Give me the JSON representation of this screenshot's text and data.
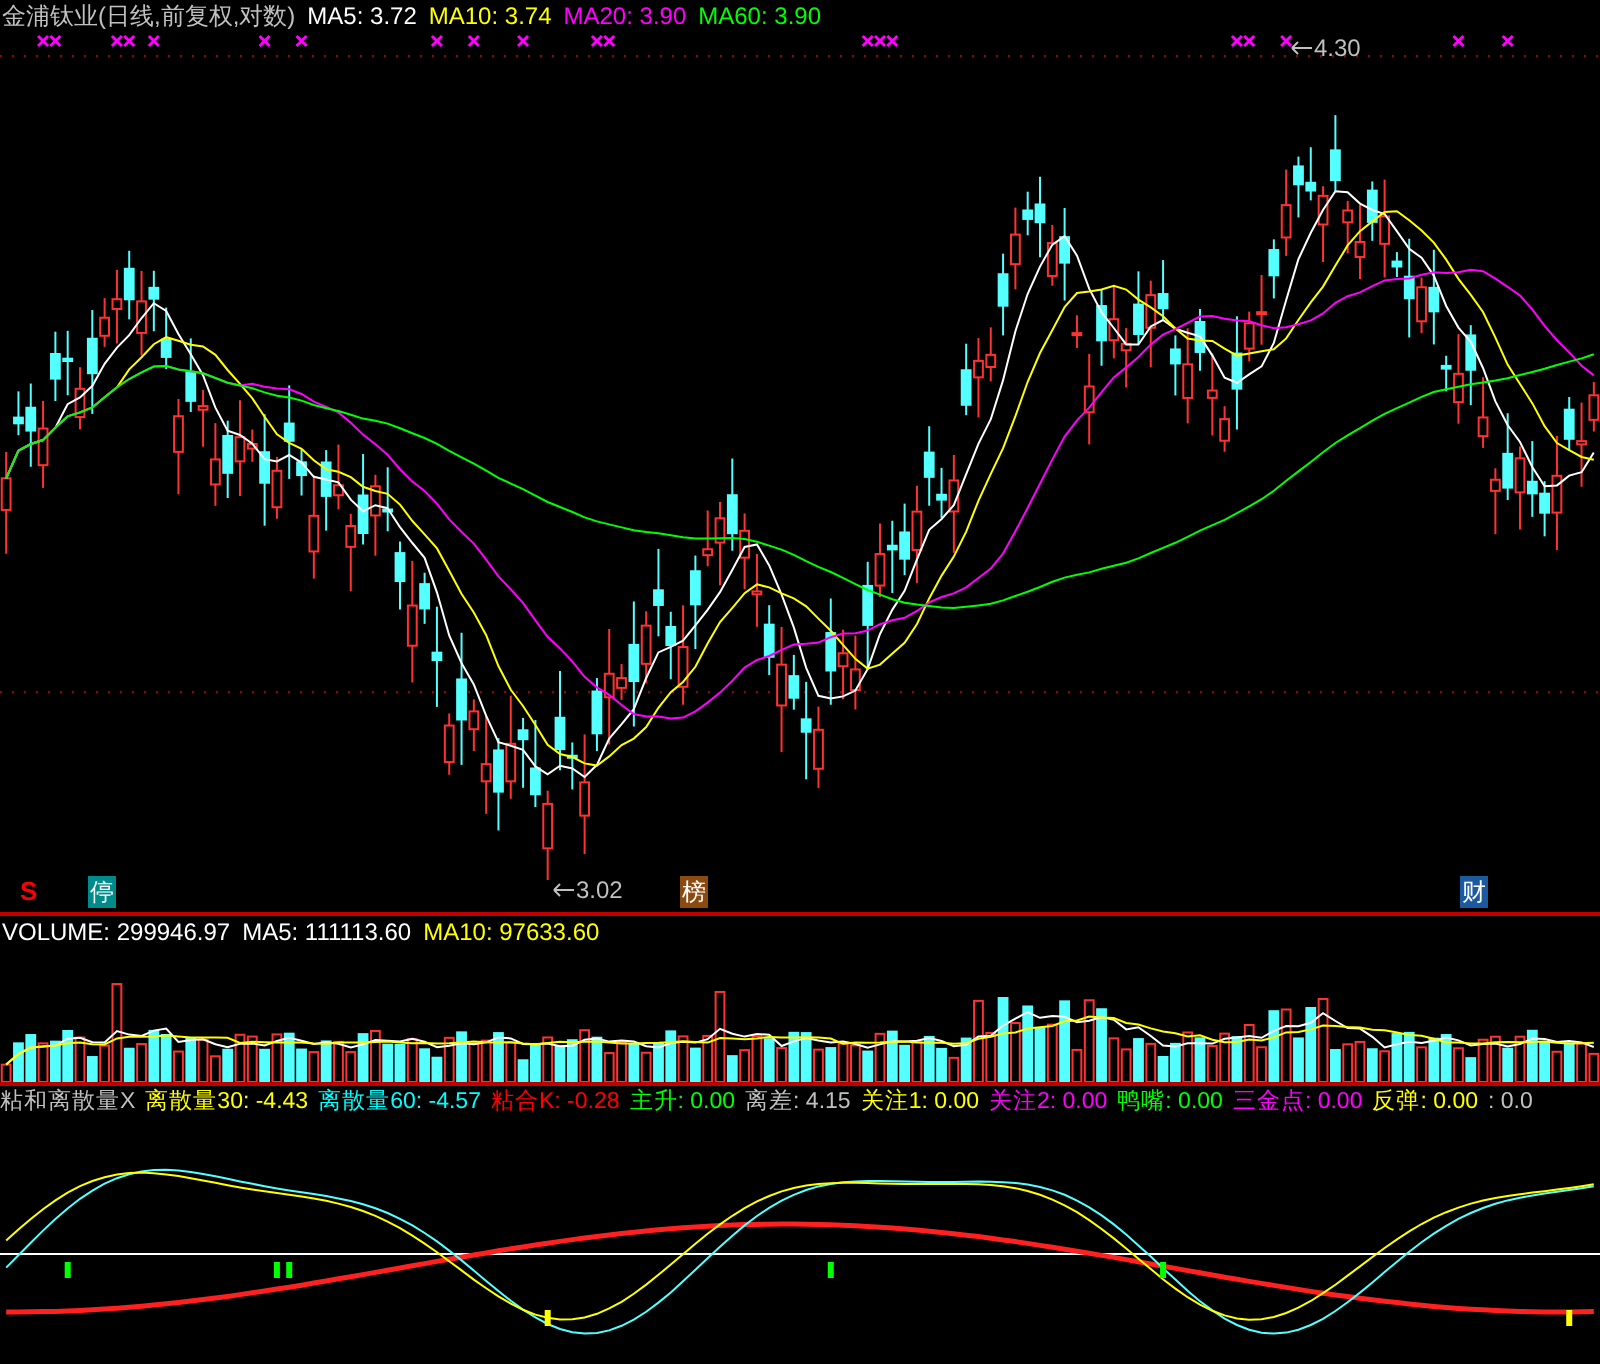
{
  "header": {
    "title": "金浦钛业(日线,前复权,对数)",
    "items": [
      {
        "label": "MA5: 3.72",
        "color": "#ffffff"
      },
      {
        "label": "MA10: 3.74",
        "color": "#ffff00"
      },
      {
        "label": "MA20: 3.90",
        "color": "#ff00ff"
      },
      {
        "label": "MA60: 3.90",
        "color": "#00ff00"
      }
    ]
  },
  "price_labels": [
    {
      "text": "4.30",
      "kind": "high"
    },
    {
      "text": "3.02",
      "kind": "low"
    }
  ],
  "event_badges": [
    {
      "text": "S",
      "kind": "signal",
      "color": "#ff0000"
    },
    {
      "text": "停",
      "kind": "tag",
      "color": "#008b8b"
    },
    {
      "text": "榜",
      "kind": "tag",
      "color": "#8b4a10"
    },
    {
      "text": "财",
      "kind": "tag",
      "color": "#1c5aa0"
    }
  ],
  "volume": {
    "items": [
      {
        "label": "VOLUME: 299946.97",
        "color": "#ffffff"
      },
      {
        "label": "MA5: 111113.60",
        "color": "#ffffff"
      },
      {
        "label": "MA10: 97633.60",
        "color": "#ffff00"
      }
    ]
  },
  "indicator": {
    "items": [
      {
        "label": "粘和离散量X",
        "color": "#c0c0c0"
      },
      {
        "label": "离散量30: -4.43",
        "color": "#ffff00"
      },
      {
        "label": "离散量60: -4.57",
        "color": "#00ffff"
      },
      {
        "label": "粘合K: -0.28",
        "color": "#ff0000"
      },
      {
        "label": "主升: 0.00",
        "color": "#00ff00"
      },
      {
        "label": "离差: 4.15",
        "color": "#c0c0c0"
      },
      {
        "label": "关注1: 0.00",
        "color": "#ffff00"
      },
      {
        "label": "关注2: 0.00",
        "color": "#ff00ff"
      },
      {
        "label": "鸭嘴: 0.00",
        "color": "#00ff00"
      },
      {
        "label": "三金点: 0.00",
        "color": "#ff00ff"
      },
      {
        "label": "反弹: 0.00",
        "color": "#ffff00"
      },
      {
        "label": ": 0.0",
        "color": "#c0c0c0"
      }
    ]
  }
}
